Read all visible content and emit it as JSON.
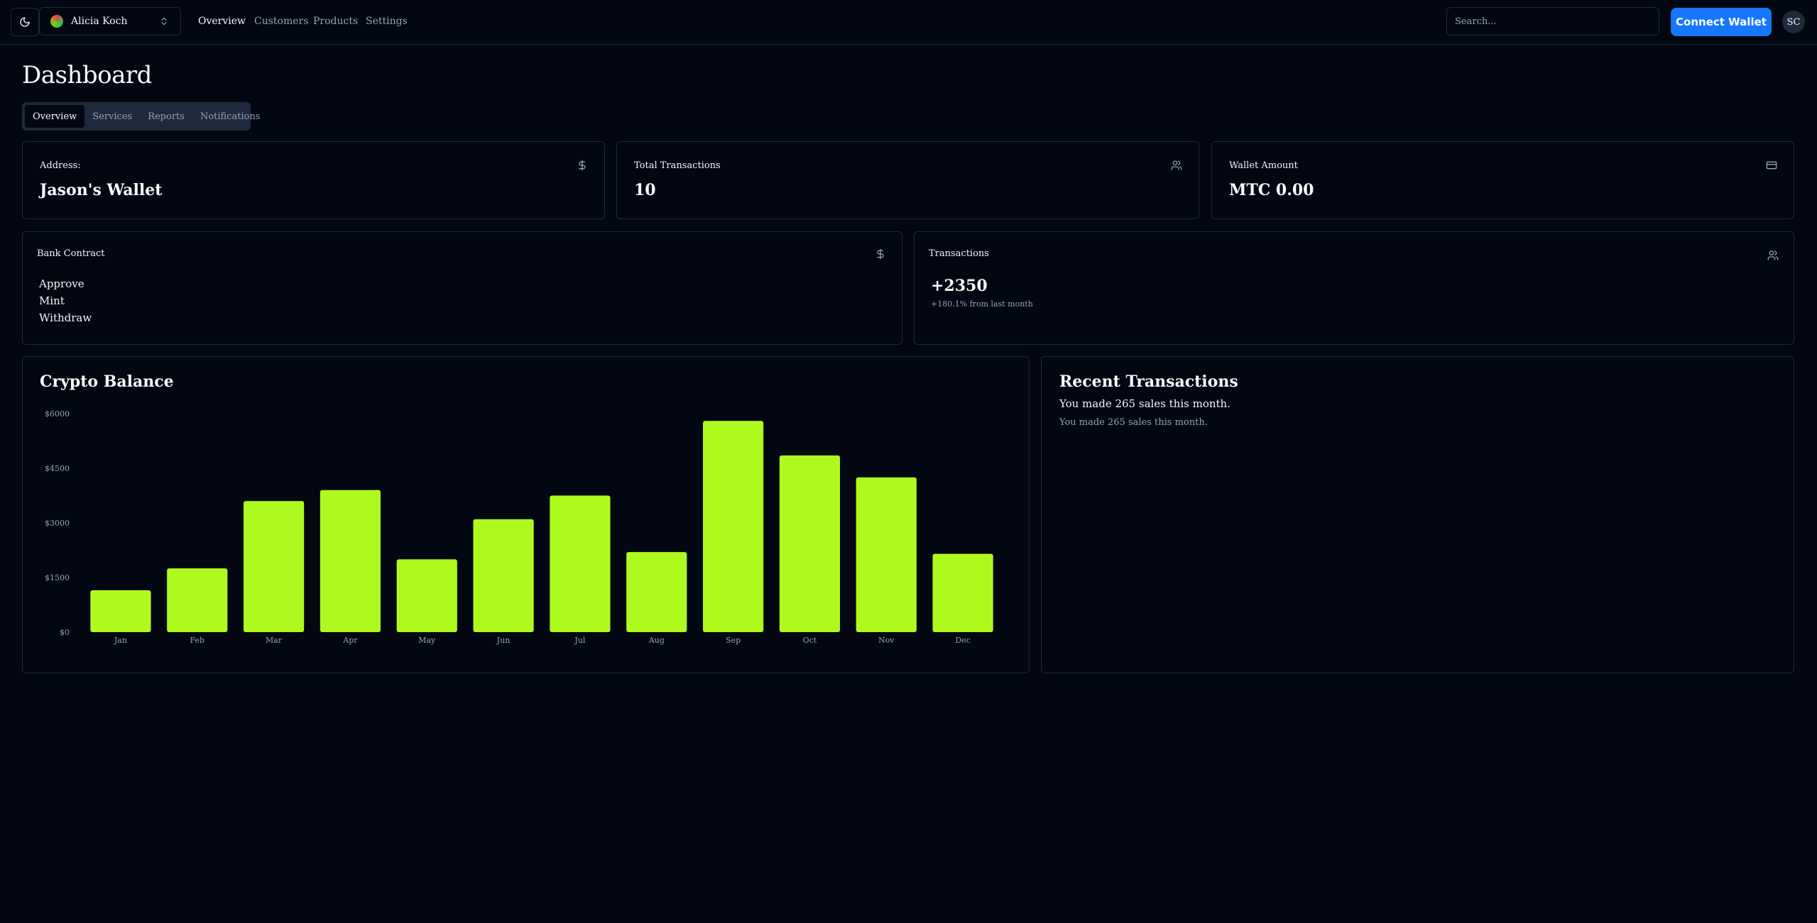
{
  "topbar": {
    "theme_icon": "moon-icon",
    "team_name": "Alicia Koch",
    "team_chevron_icon": "chevrons-up-down-icon",
    "nav": [
      {
        "label": "Overview",
        "active": true
      },
      {
        "label": "Customers",
        "active": false
      },
      {
        "label": "Products",
        "active": false
      },
      {
        "label": "Settings",
        "active": false
      }
    ],
    "search_placeholder": "Search...",
    "connect_label": "Connect Wallet",
    "avatar_initials": "SC",
    "accent_color": "#1677ff"
  },
  "page": {
    "title": "Dashboard",
    "tabs": [
      {
        "label": "Overview",
        "active": true
      },
      {
        "label": "Services",
        "active": false
      },
      {
        "label": "Reports",
        "active": false
      },
      {
        "label": "Notifications",
        "active": false
      }
    ]
  },
  "stats": [
    {
      "label": "Address:",
      "value": "Jason's Wallet",
      "icon": "dollar-icon"
    },
    {
      "label": "Total Transactions",
      "value": "10",
      "icon": "users-icon"
    },
    {
      "label": "Wallet Amount",
      "value": "MTC 0.00",
      "icon": "credit-card-icon"
    }
  ],
  "bank_contract": {
    "label": "Bank Contract",
    "icon": "dollar-icon",
    "actions": [
      "Approve",
      "Mint",
      "Withdraw"
    ]
  },
  "transactions": {
    "label": "Transactions",
    "icon": "users-icon",
    "value": "+2350",
    "note": "+180.1% from last month"
  },
  "crypto_balance": {
    "title": "Crypto Balance"
  },
  "recent": {
    "title": "Recent Transactions",
    "line1": "You made 265 sales this month.",
    "line2": "You made 265 sales this month."
  },
  "chart_data": {
    "type": "bar",
    "categories": [
      "Jan",
      "Feb",
      "Mar",
      "Apr",
      "May",
      "Jun",
      "Jul",
      "Aug",
      "Sep",
      "Oct",
      "Nov",
      "Dec"
    ],
    "values": [
      1150,
      1750,
      3600,
      3900,
      2000,
      3100,
      3750,
      2200,
      5800,
      4850,
      4250,
      2150
    ],
    "y_ticks": [
      "$0",
      "$1500",
      "$3000",
      "$4500",
      "$6000"
    ],
    "ylim": [
      0,
      6000
    ],
    "bar_color": "#aefa1f",
    "grid": false,
    "title": "",
    "xlabel": "",
    "ylabel": ""
  }
}
